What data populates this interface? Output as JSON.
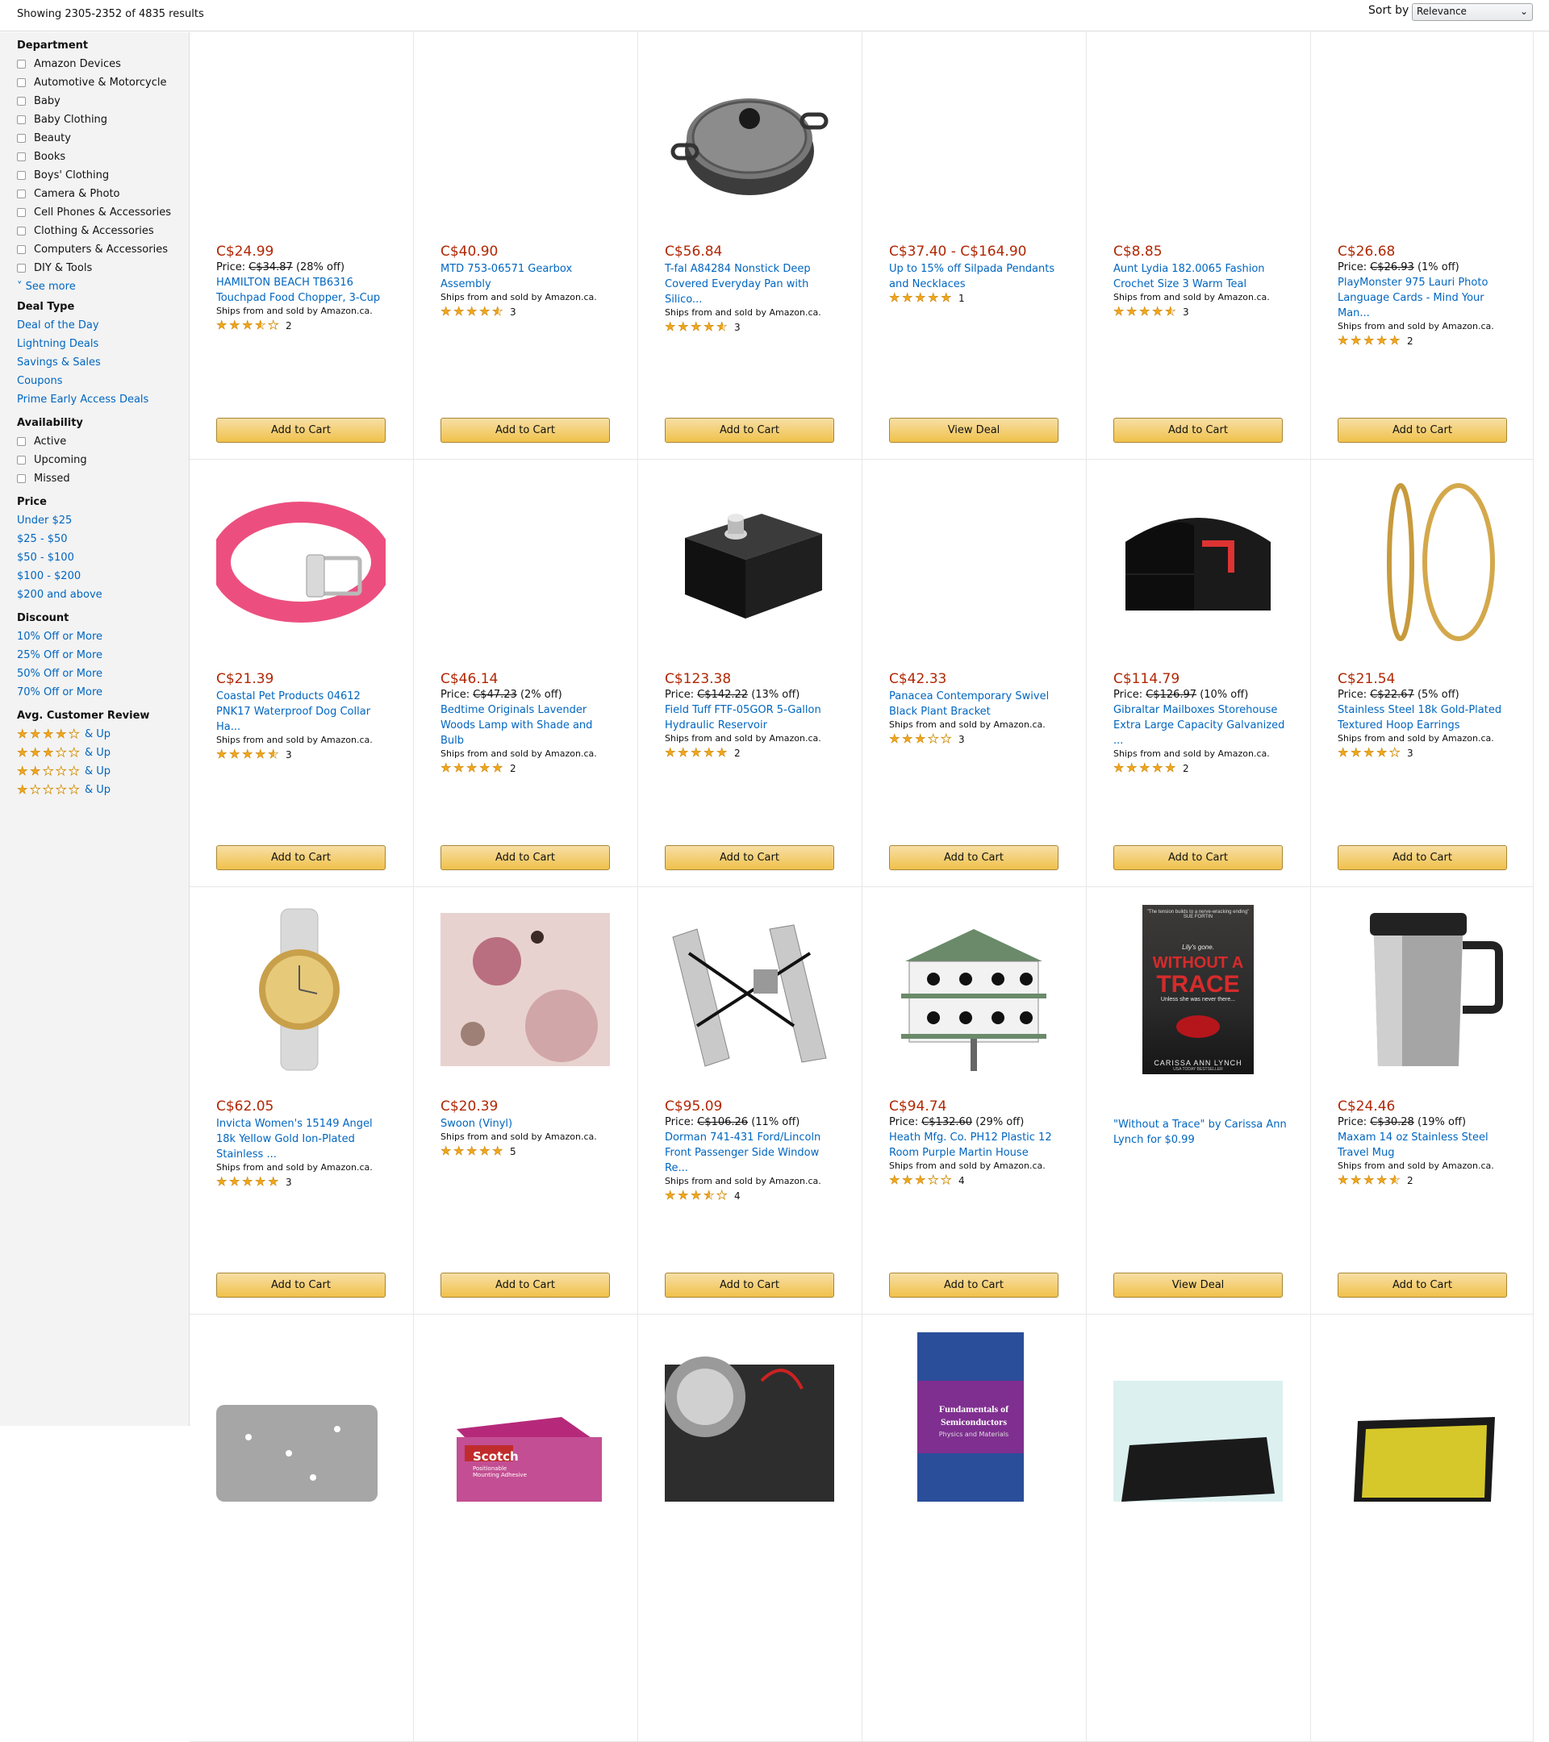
{
  "header": {
    "results_text": "Showing 2305-2352 of 4835 results",
    "sort_label": "Sort by",
    "sort_value": "Relevance"
  },
  "sidebar": {
    "department_heading": "Department",
    "departments": [
      "Amazon Devices",
      "Automotive & Motorcycle",
      "Baby",
      "Baby Clothing",
      "Beauty",
      "Books",
      "Boys' Clothing",
      "Camera & Photo",
      "Cell Phones & Accessories",
      "Clothing & Accessories",
      "Computers & Accessories",
      "DIY & Tools"
    ],
    "see_more": "See more",
    "deal_type_heading": "Deal Type",
    "deal_types": [
      "Deal of the Day",
      "Lightning Deals",
      "Savings & Sales",
      "Coupons",
      "Prime Early Access Deals"
    ],
    "availability_heading": "Availability",
    "availability": [
      "Active",
      "Upcoming",
      "Missed"
    ],
    "price_heading": "Price",
    "prices": [
      "Under $25",
      "$25 - $50",
      "$50 - $100",
      "$100 - $200",
      "$200 and above"
    ],
    "discount_heading": "Discount",
    "discounts": [
      "10% Off or More",
      "25% Off or More",
      "50% Off or More",
      "70% Off or More"
    ],
    "review_heading": "Avg. Customer Review",
    "review_stars": [
      4,
      3,
      2,
      1
    ],
    "review_suffix": "& Up"
  },
  "products": [
    {
      "price": "C$24.99",
      "orig_label": "Price:",
      "orig_price": "C$34.87",
      "orig_pct": "(28% off)",
      "title": "HAMILTON BEACH TB6316 Touchpad Food Chopper, 3-Cup",
      "ships": "Ships from and sold by Amazon.ca.",
      "rating": 3.5,
      "count": "2",
      "button": "Add to Cart",
      "image": "none"
    },
    {
      "price": "C$40.90",
      "orig_label": "",
      "orig_price": "",
      "orig_pct": "",
      "title": "MTD 753-06571 Gearbox Assembly",
      "ships": "Ships from and sold by Amazon.ca.",
      "rating": 4.5,
      "count": "3",
      "button": "Add to Cart",
      "image": "none"
    },
    {
      "price": "C$56.84",
      "orig_label": "",
      "orig_price": "",
      "orig_pct": "",
      "title": "T-fal A84284 Nonstick Deep Covered Everyday Pan with Silico...",
      "ships": "Ships from and sold by Amazon.ca.",
      "rating": 4.5,
      "count": "3",
      "button": "Add to Cart",
      "image": "pan"
    },
    {
      "price": "C$37.40 - C$164.90",
      "orig_label": "",
      "orig_price": "",
      "orig_pct": "",
      "title": "Up to 15% off Silpada Pendants and Necklaces",
      "ships": "",
      "rating": 5,
      "count": "1",
      "button": "View Deal",
      "image": "none"
    },
    {
      "price": "C$8.85",
      "orig_label": "",
      "orig_price": "",
      "orig_pct": "",
      "title": "Aunt Lydia 182.0065 Fashion Crochet Size 3 Warm Teal",
      "ships": "Ships from and sold by Amazon.ca.",
      "rating": 4.5,
      "count": "3",
      "button": "Add to Cart",
      "image": "none"
    },
    {
      "price": "C$26.68",
      "orig_label": "Price:",
      "orig_price": "C$26.93",
      "orig_pct": "(1% off)",
      "title": "PlayMonster 975 Lauri Photo Language Cards - Mind Your Man...",
      "ships": "Ships from and sold by Amazon.ca.",
      "rating": 5,
      "count": "2",
      "button": "Add to Cart",
      "image": "none"
    },
    {
      "price": "C$21.39",
      "orig_label": "",
      "orig_price": "",
      "orig_pct": "",
      "title": "Coastal Pet Products 04612 PNK17 Waterproof Dog Collar Ha...",
      "ships": "Ships from and sold by Amazon.ca.",
      "rating": 4.5,
      "count": "3",
      "button": "Add to Cart",
      "image": "collar"
    },
    {
      "price": "C$46.14",
      "orig_label": "Price:",
      "orig_price": "C$47.23",
      "orig_pct": "(2% off)",
      "title": "Bedtime Originals Lavender Woods Lamp with Shade and Bulb",
      "ships": "Ships from and sold by Amazon.ca.",
      "rating": 5,
      "count": "2",
      "button": "Add to Cart",
      "image": "none"
    },
    {
      "price": "C$123.38",
      "orig_label": "Price:",
      "orig_price": "C$142.22",
      "orig_pct": "(13% off)",
      "title": "Field Tuff FTF-05GOR 5-Gallon Hydraulic Reservoir",
      "ships": "Ships from and sold by Amazon.ca.",
      "rating": 5,
      "count": "2",
      "button": "Add to Cart",
      "image": "tank"
    },
    {
      "price": "C$42.33",
      "orig_label": "",
      "orig_price": "",
      "orig_pct": "",
      "title": "Panacea Contemporary Swivel Black Plant Bracket",
      "ships": "Ships from and sold by Amazon.ca.",
      "rating": 3,
      "count": "3",
      "button": "Add to Cart",
      "image": "none"
    },
    {
      "price": "C$114.79",
      "orig_label": "Price:",
      "orig_price": "C$126.97",
      "orig_pct": "(10% off)",
      "title": "Gibraltar Mailboxes Storehouse Extra Large Capacity Galvanized ...",
      "ships": "Ships from and sold by Amazon.ca.",
      "rating": 5,
      "count": "2",
      "button": "Add to Cart",
      "image": "mailbox"
    },
    {
      "price": "C$21.54",
      "orig_label": "Price:",
      "orig_price": "C$22.67",
      "orig_pct": "(5% off)",
      "title": "Stainless Steel 18k Gold-Plated Textured Hoop Earrings",
      "ships": "Ships from and sold by Amazon.ca.",
      "rating": 4,
      "count": "3",
      "button": "Add to Cart",
      "image": "hoops"
    },
    {
      "price": "C$62.05",
      "orig_label": "",
      "orig_price": "",
      "orig_pct": "",
      "title": "Invicta Women's 15149 Angel 18k Yellow Gold Ion-Plated Stainless ...",
      "ships": "Ships from and sold by Amazon.ca.",
      "rating": 5,
      "count": "3",
      "button": "Add to Cart",
      "image": "watch"
    },
    {
      "price": "C$20.39",
      "orig_label": "",
      "orig_price": "",
      "orig_pct": "",
      "title": "Swoon (Vinyl)",
      "ships": "Ships from and sold by Amazon.ca.",
      "rating": 5,
      "count": "5",
      "button": "Add to Cart",
      "image": "album"
    },
    {
      "price": "C$95.09",
      "orig_label": "Price:",
      "orig_price": "C$106.26",
      "orig_pct": "(11% off)",
      "title": "Dorman 741-431 Ford/Lincoln Front Passenger Side Window Re...",
      "ships": "Ships from and sold by Amazon.ca.",
      "rating": 3.5,
      "count": "4",
      "button": "Add to Cart",
      "image": "regulator"
    },
    {
      "price": "C$94.74",
      "orig_label": "Price:",
      "orig_price": "C$132.60",
      "orig_pct": "(29% off)",
      "title": "Heath Mfg. Co. PH12 Plastic 12 Room Purple Martin House",
      "ships": "Ships from and sold by Amazon.ca.",
      "rating": 3,
      "count": "4",
      "button": "Add to Cart",
      "image": "birdhouse"
    },
    {
      "price": "",
      "orig_label": "",
      "orig_price": "",
      "orig_pct": "",
      "title": "\"Without a Trace\" by Carissa Ann Lynch for $0.99",
      "ships": "",
      "rating": 0,
      "count": "",
      "button": "View Deal",
      "image": "book",
      "book_quote": "\"The tension builds to a nerve-wracking ending\" SUE FORTIN",
      "book_tag": "Lily's gone.",
      "book_title1": "WITHOUT A",
      "book_title2": "TRACE",
      "book_sub": "Unless she was never there...",
      "book_author": "CARISSA ANN LYNCH",
      "book_badge": "USA TODAY BESTSELLER"
    },
    {
      "price": "C$24.46",
      "orig_label": "Price:",
      "orig_price": "C$30.28",
      "orig_pct": "(19% off)",
      "title": "Maxam 14 oz Stainless Steel Travel Mug",
      "ships": "Ships from and sold by Amazon.ca.",
      "rating": 4.5,
      "count": "2",
      "button": "Add to Cart",
      "image": "mug"
    },
    {
      "image": "sheets"
    },
    {
      "image": "scotch",
      "label": "Scotch",
      "sub": "Positionable Mounting Adhesive"
    },
    {
      "image": "car"
    },
    {
      "image": "textbook",
      "label1": "Fundamentals of",
      "label2": "Semiconductors",
      "sub": "Physics and Materials"
    },
    {
      "image": "keyboard"
    },
    {
      "image": "laptop"
    }
  ]
}
